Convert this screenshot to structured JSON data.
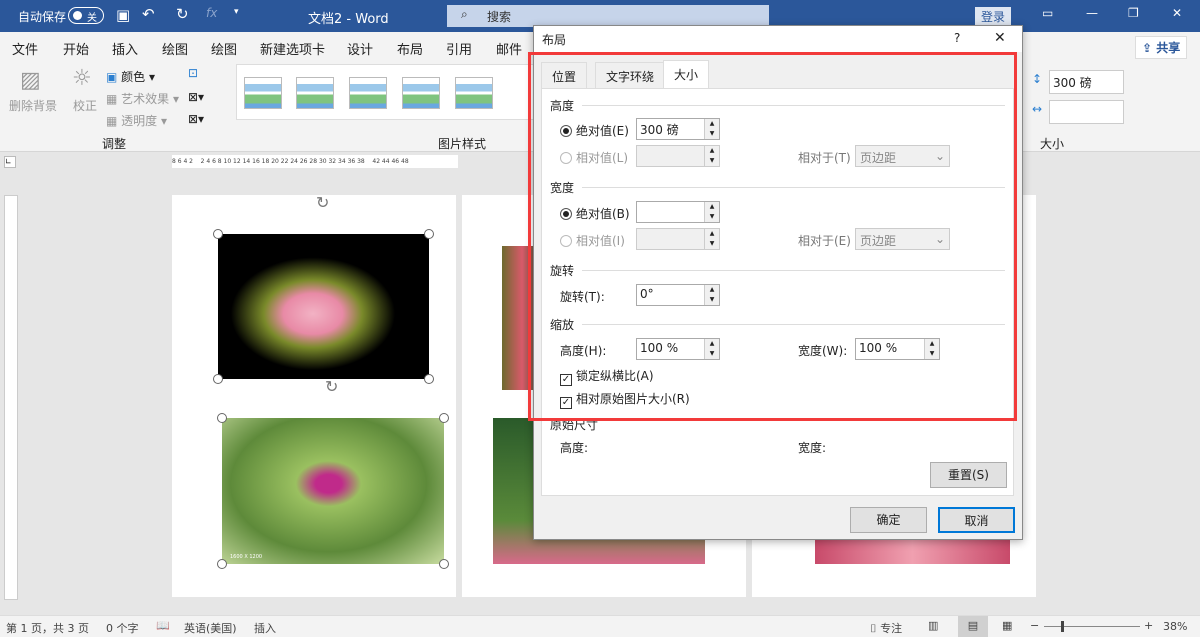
{
  "titlebar": {
    "autosave": "自动保存",
    "toggle": "关",
    "title": "文档2  -  Word",
    "search": "搜索",
    "login": "登录"
  },
  "ribbon_tabs": [
    "文件",
    "开始",
    "插入",
    "绘图",
    "绘图",
    "新建选项卡",
    "设计",
    "布局",
    "引用",
    "邮件"
  ],
  "share": "共享",
  "ribbon": {
    "remove_bg": "删除背景",
    "correct": "校正",
    "color": "颜色",
    "art": "艺术效果",
    "transparency": "透明度",
    "adjust_group": "调整",
    "styles_group": "图片样式",
    "size_group": "大小",
    "height_value": "300 磅",
    "width_value": ""
  },
  "ruler_numbers": "8 6 4 2    2 4 6 8 10 12 14 16 18 20 22 24 26 28 30 32 34 36 38    42 44 46 48",
  "image_caption": "1600 X 1200",
  "dialog": {
    "title": "布局",
    "help": "?",
    "close": "✕",
    "tabs": [
      "位置",
      "文字环绕",
      "大小"
    ],
    "height": {
      "section": "高度",
      "absolute": "绝对值(E)",
      "absolute_value": "300 磅",
      "relative": "相对值(L)",
      "relative_to": "相对于(T)",
      "relative_to_value": "页边距"
    },
    "width": {
      "section": "宽度",
      "absolute": "绝对值(B)",
      "absolute_value": "",
      "relative": "相对值(I)",
      "relative_to": "相对于(E)",
      "relative_to_value": "页边距"
    },
    "rotate": {
      "section": "旋转",
      "label": "旋转(T):",
      "value": "0°"
    },
    "scale": {
      "section": "缩放",
      "height_label": "高度(H):",
      "height_value": "100 %",
      "width_label": "宽度(W):",
      "width_value": "100 %",
      "lock": "锁定纵横比(A)",
      "relative_original": "相对原始图片大小(R)"
    },
    "original": {
      "section": "原始尺寸",
      "height": "高度:",
      "width": "宽度:"
    },
    "reset": "重置(S)",
    "ok": "确定",
    "cancel": "取消"
  },
  "status": {
    "page": "第 1 页，共 3 页",
    "words": "0 个字",
    "lang": "英语(美国)",
    "mode": "插入",
    "focus": "专注",
    "zoom": "38%"
  }
}
